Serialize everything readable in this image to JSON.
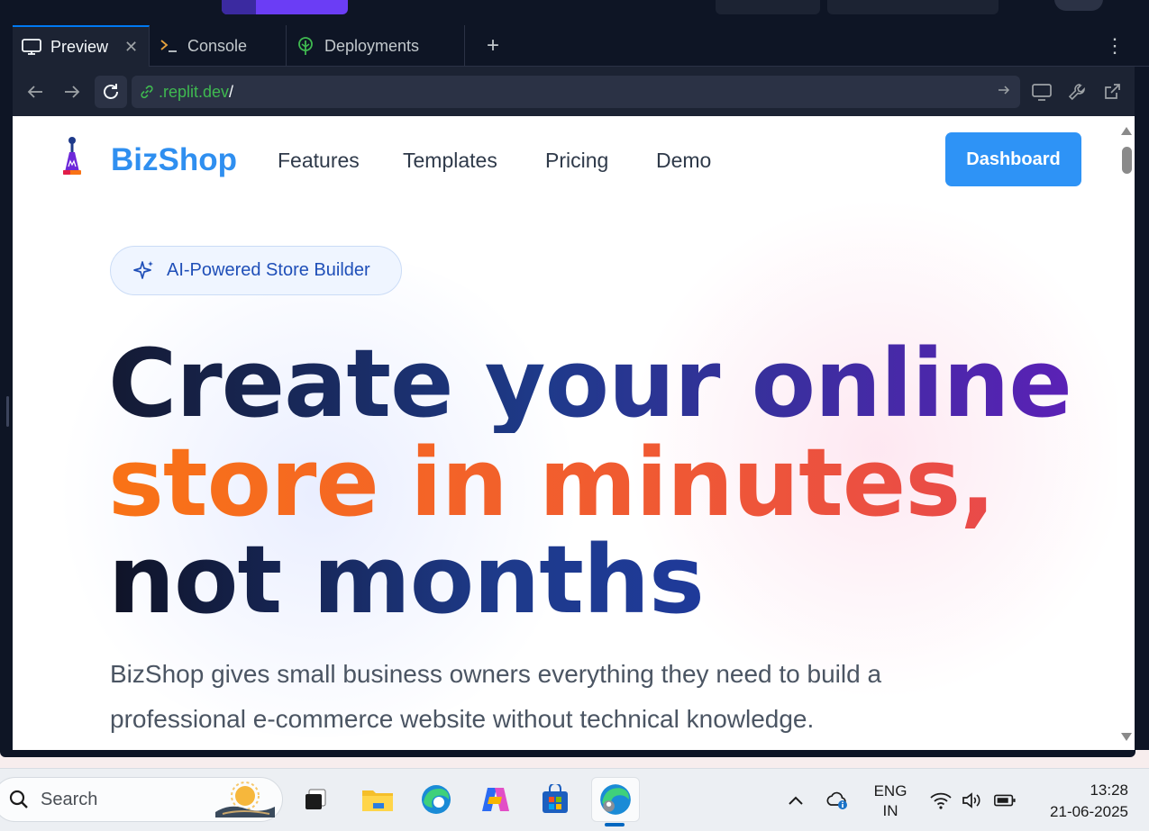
{
  "ide": {
    "tabs": [
      {
        "label": "Preview",
        "icon": "monitor-icon",
        "closable": true,
        "active": true
      },
      {
        "label": "Console",
        "icon": "terminal-icon",
        "closable": false,
        "active": false
      },
      {
        "label": "Deployments",
        "icon": "deploy-tree-icon",
        "closable": false,
        "active": false
      }
    ],
    "new_tab_label": "+",
    "menu_label": "⋮",
    "url_prefix": ".replit.dev",
    "url_suffix": "/",
    "accent_color": "#0079f2"
  },
  "site": {
    "brand": "BizShop",
    "nav": [
      "Features",
      "Templates",
      "Pricing",
      "Demo"
    ],
    "cta": "Dashboard",
    "badge": "AI-Powered Store Builder",
    "headline": {
      "line1": "Create your online",
      "line2": "store in minutes,",
      "line3": "not months"
    },
    "subheadline": "BizShop gives small business owners everything they need to build a professional e-commerce website without technical knowledge.",
    "colors": {
      "brand": "#2f8ff0",
      "cta": "#2e93f6",
      "orange": "#f97316",
      "navy": "#1e3a8a",
      "purple": "#5b21b6"
    }
  },
  "taskbar": {
    "search_placeholder": "Search",
    "apps": [
      "task-view-icon",
      "file-explorer-icon",
      "edge-icon",
      "copilot-icon",
      "microsoft-store-icon",
      "edge-active-icon"
    ],
    "lang_line1": "ENG",
    "lang_line2": "IN",
    "time": "13:28",
    "date": "21-06-2025"
  }
}
